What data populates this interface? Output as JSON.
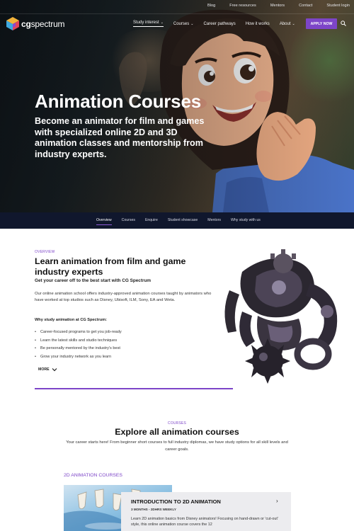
{
  "topbar": {
    "links": [
      "Blog",
      "Free resources",
      "Mentors",
      "Contact",
      "Student login"
    ]
  },
  "brand": {
    "logo_bold": "cg",
    "logo_rest": "spectrum"
  },
  "nav": {
    "items": [
      {
        "label": "Study interest",
        "has_dropdown": true
      },
      {
        "label": "Courses",
        "has_dropdown": true
      },
      {
        "label": "Career pathways",
        "has_dropdown": false
      },
      {
        "label": "How it works",
        "has_dropdown": false
      },
      {
        "label": "About",
        "has_dropdown": true
      }
    ],
    "apply_label": "APPLY NOW",
    "accent": "#7d45c8"
  },
  "hero": {
    "title": "Animation Courses",
    "subtitle": "Become an animator for film and games with specialized online 2D and 3D animation classes and mentorship from industry experts."
  },
  "subnav": {
    "items": [
      "Overview",
      "Courses",
      "Enquire",
      "Student showcase",
      "Mentors",
      "Why study with us"
    ],
    "active": "Overview"
  },
  "overview": {
    "eyebrow": "OVERVIEW",
    "title": "Learn animation from film and game industry experts",
    "subtitle": "Get your career off to the best start with CG Spectrum",
    "body": "Our online animation school offers industry-approved animation courses taught by animators who have worked at top studios such as Disney, Ubisoft, ILM, Sony, EA and Weta.",
    "why_heading": "Why study animation at CG Spectrum:",
    "bullets": [
      "Career-focused programs to get you job-ready",
      "Learn the latest skills and studio techniques",
      "Be personally mentored by the industry's best",
      "Grow your industry network as you learn"
    ],
    "more_label": "MORE"
  },
  "courses": {
    "eyebrow": "COURSES",
    "title": "Explore all animation courses",
    "subtitle": "Your career starts here! From beginner short courses to full industry diplomas, we have study options for all skill levels and career goals.",
    "category": "2D ANIMATION COURSES",
    "card": {
      "title": "INTRODUCTION TO 2D ANIMATION",
      "meta": "3 MONTHS - 2DHRS WEEKLY",
      "description": "Learn 2D animation basics from Disney animators! Focusing on hand-drawn or 'cut-out' style, this online animation course covers the 12"
    }
  }
}
